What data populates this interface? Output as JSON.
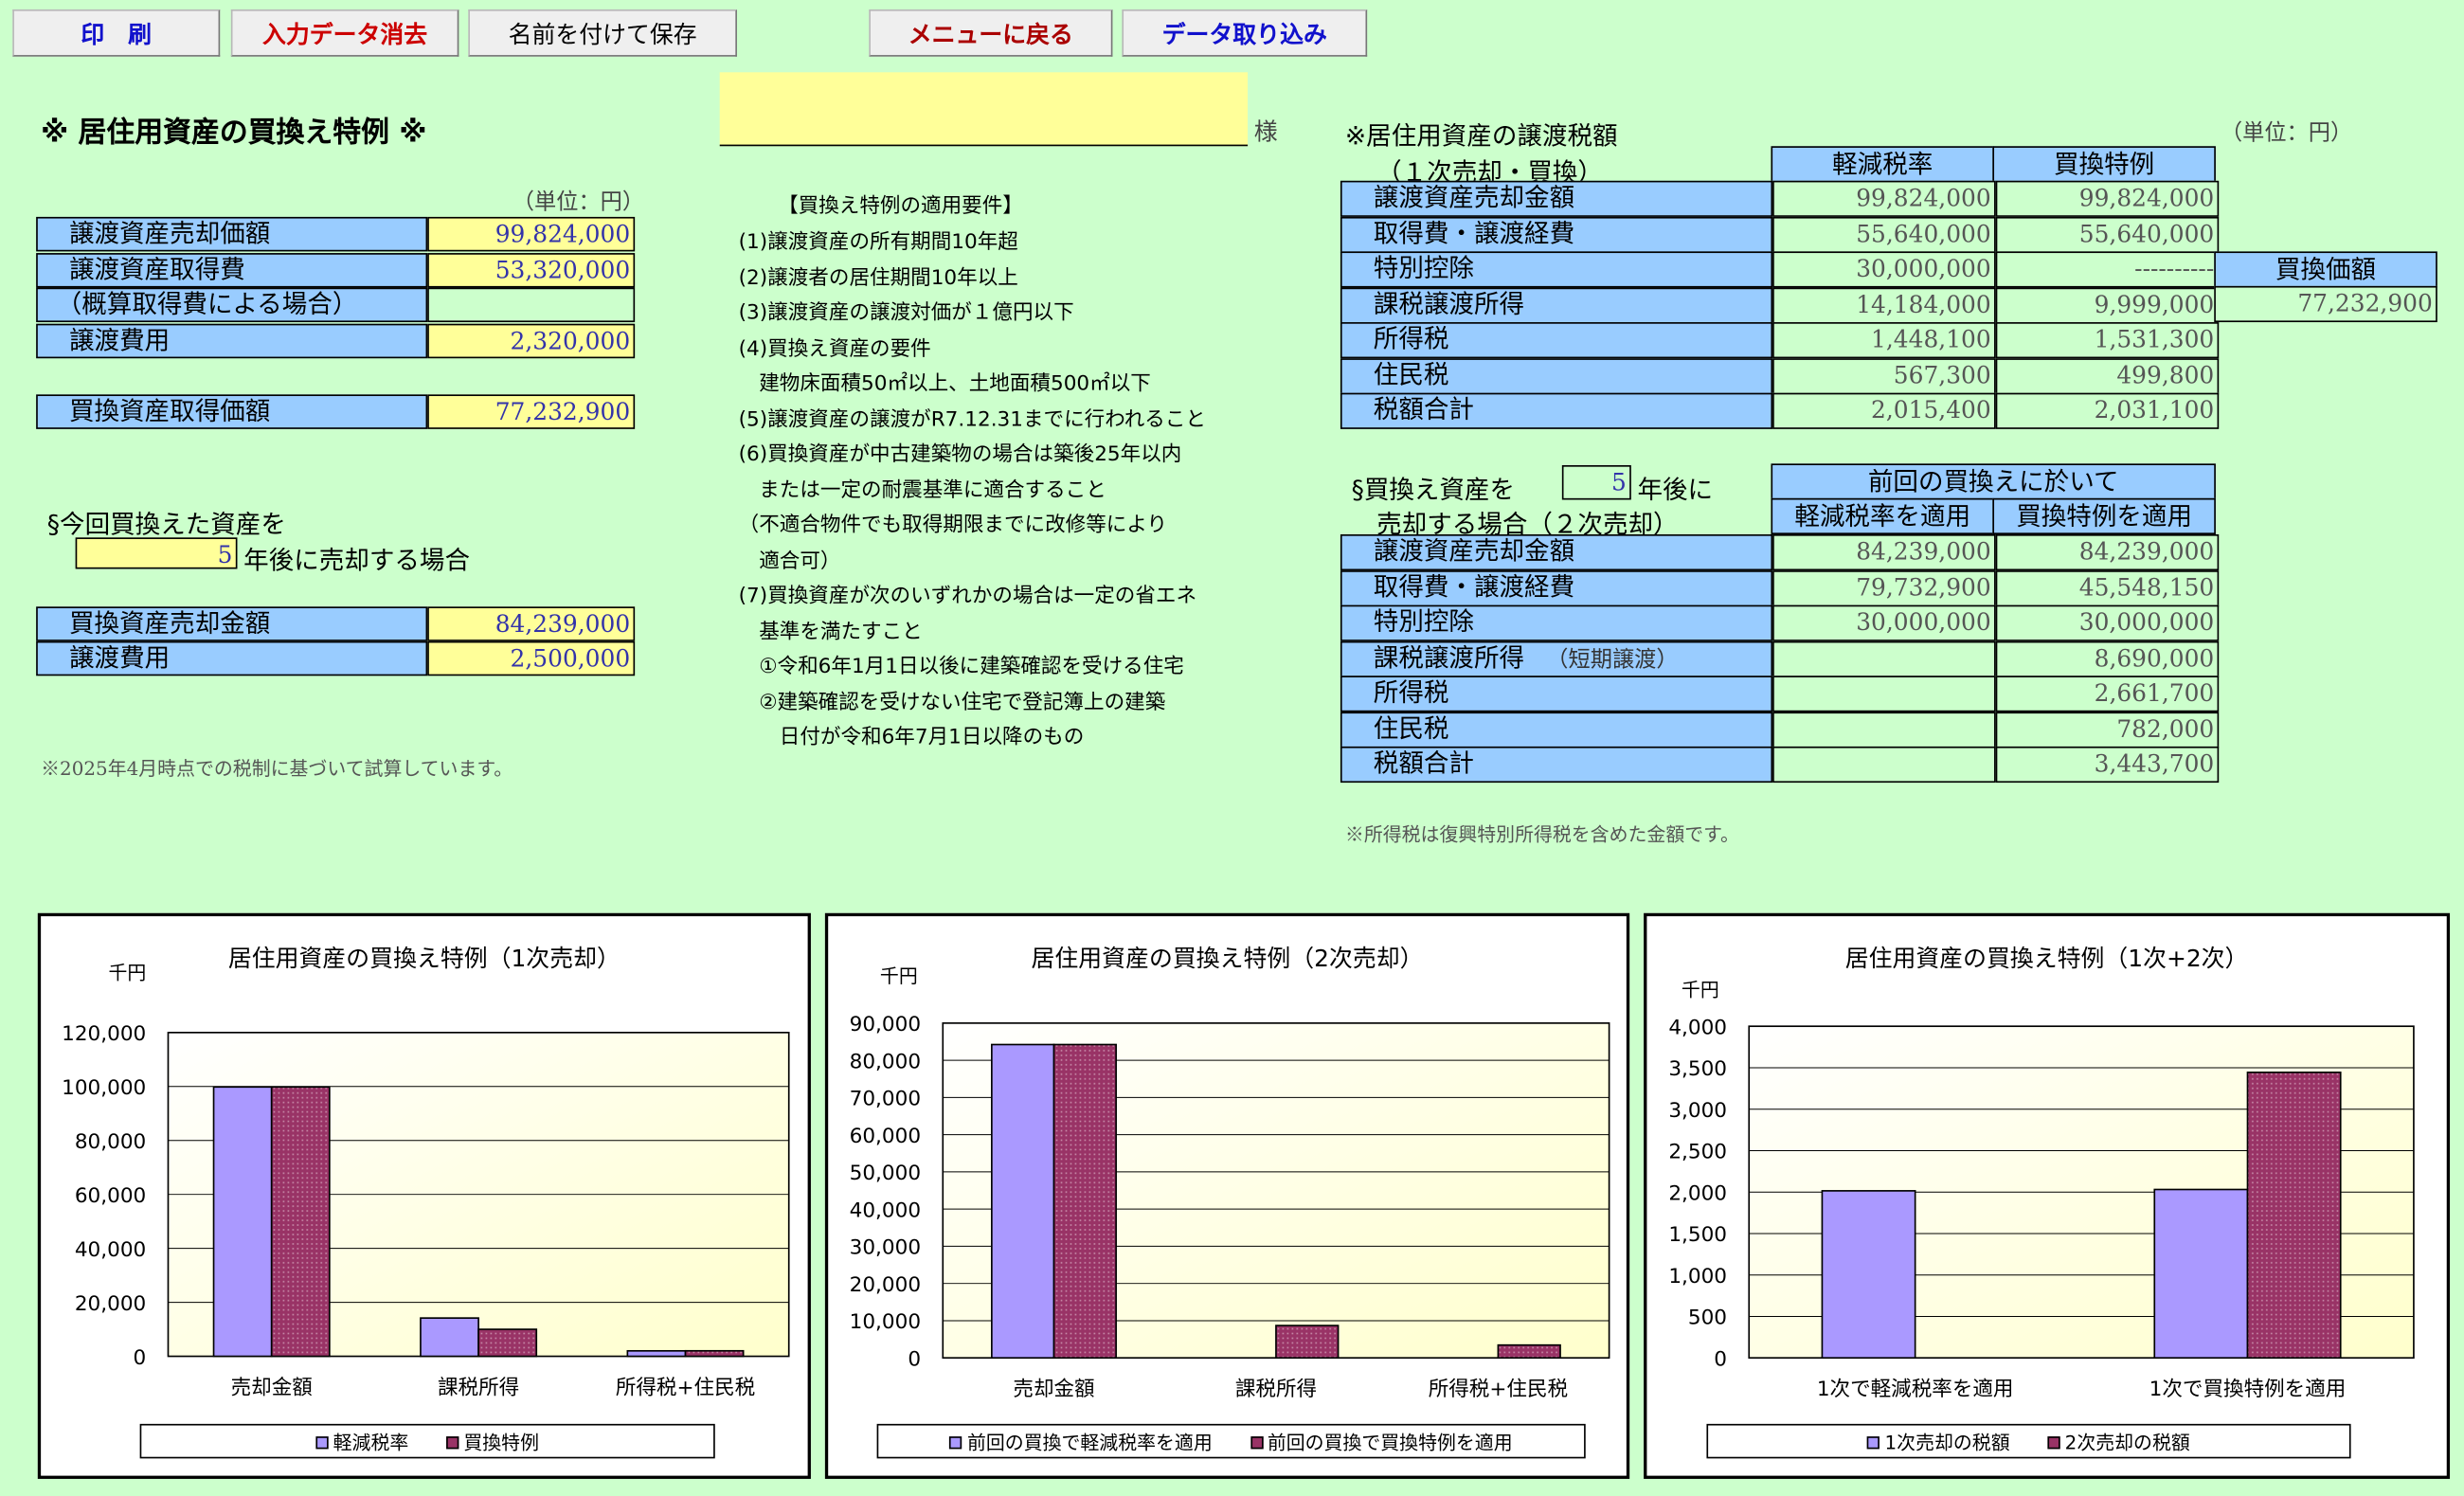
{
  "toolbar": {
    "print": "印　刷",
    "clear": "入力データ消去",
    "save_as": "名前を付けて保存",
    "menu": "メニューに戻る",
    "import": "データ取り込み"
  },
  "colors": {
    "background": "#ccffcc",
    "label_cell": "#99ccff",
    "input_cell": "#ffff99",
    "series_a": "#aa99ff",
    "series_b": "#993366",
    "plot_bg": "#ffffcc"
  },
  "left": {
    "title": "※ 居住用資産の買換え特例 ※",
    "client_name": "",
    "sama": "様",
    "unit": "（単位：円）",
    "rows": [
      {
        "label": "譲渡資産売却価額",
        "value": "99,824,000"
      },
      {
        "label": "譲渡資産取得費",
        "value": "53,320,000"
      },
      {
        "label": "（概算取得費による場合）",
        "value": ""
      },
      {
        "label": "譲渡費用",
        "value": "2,320,000"
      }
    ],
    "replacement": {
      "label": "買換資産取得価額",
      "value": "77,232,900"
    },
    "sale_heading1": "§今回買換えた資産を",
    "sale_years": "5",
    "sale_heading2": "年後に売却する場合",
    "sale_rows": [
      {
        "label": "買換資産売却金額",
        "value": "84,239,000"
      },
      {
        "label": "譲渡費用",
        "value": "2,500,000"
      }
    ],
    "note": "※2025年4月時点での税制に基づいて試算しています。"
  },
  "requirements": {
    "title": "【買換え特例の適用要件】",
    "lines": [
      "(1)譲渡資産の所有期間10年超",
      "(2)譲渡者の居住期間10年以上",
      "(3)譲渡資産の譲渡対価が１億円以下",
      "(4)買換え資産の要件",
      "　建物床面積50㎡以上、土地面積500㎡以下",
      "(5)譲渡資産の譲渡がR7.12.31までに行われること",
      "(6)買換資産が中古建築物の場合は築後25年以内",
      "　または一定の耐震基準に適合すること",
      "（不適合物件でも取得期限までに改修等により",
      "　適合可）",
      "(7)買換資産が次のいずれかの場合は一定の省エネ",
      "　基準を満たすこと",
      "　①令和6年1月1日以後に建築確認を受ける住宅",
      "　②建築確認を受けない住宅で登記簿上の建築",
      "　　日付が令和6年7月1日以降のもの"
    ]
  },
  "right": {
    "title": "※居住用資産の譲渡税額",
    "unit": "（単位：円）",
    "subtitle": "（１次売却・買換）",
    "col1": "軽減税率",
    "col2": "買換特例",
    "rows": [
      {
        "label": "譲渡資産売却金額",
        "a": "99,824,000",
        "b": "99,824,000"
      },
      {
        "label": "取得費・譲渡経費",
        "a": "55,640,000",
        "b": "55,640,000"
      },
      {
        "label": "特別控除",
        "a": "30,000,000",
        "b": "----------"
      },
      {
        "label": "課税譲渡所得",
        "a": "14,184,000",
        "b": "9,999,000"
      },
      {
        "label": "所得税",
        "a": "1,448,100",
        "b": "1,531,300"
      },
      {
        "label": "住民税",
        "a": "567,300",
        "b": "499,800"
      },
      {
        "label": "税額合計",
        "a": "2,015,400",
        "b": "2,031,100"
      }
    ],
    "kaikae_label": "買換価額",
    "kaikae_value": "77,232,900",
    "second_heading1": "§買換え資産を",
    "second_years": "5",
    "second_heading1b": "年後に",
    "second_heading2": "売却する場合（２次売却）",
    "prev_header": "前回の買換えに於いて",
    "col3": "軽減税率を適用",
    "col4": "買換特例を適用",
    "rows2": [
      {
        "label": "譲渡資産売却金額",
        "a": "84,239,000",
        "b": "84,239,000"
      },
      {
        "label": "取得費・譲渡経費",
        "a": "79,732,900",
        "b": "45,548,150"
      },
      {
        "label": "特別控除",
        "a": "30,000,000",
        "b": "30,000,000"
      },
      {
        "label": "課税譲渡所得",
        "extra": "（短期譲渡）",
        "a": "",
        "b": "8,690,000"
      },
      {
        "label": "所得税",
        "a": "",
        "b": "2,661,700"
      },
      {
        "label": "住民税",
        "a": "",
        "b": "782,000"
      },
      {
        "label": "税額合計",
        "a": "",
        "b": "3,443,700"
      }
    ],
    "note": "※所得税は復興特別所得税を含めた金額です。"
  },
  "chart_data": [
    {
      "type": "bar",
      "title": "居住用資産の買換え特例（1次売却）",
      "ylabel": "千円",
      "categories": [
        "売却金額",
        "課税所得",
        "所得税+住民税"
      ],
      "ylim": [
        0,
        120000
      ],
      "yticks": [
        "0",
        "20,000",
        "40,000",
        "60,000",
        "80,000",
        "100,000",
        "120,000"
      ],
      "series": [
        {
          "name": "軽減税率",
          "values": [
            99824,
            14184,
            2015
          ]
        },
        {
          "name": "買換特例",
          "values": [
            99824,
            9999,
            2031
          ]
        }
      ],
      "legend": "bottom"
    },
    {
      "type": "bar",
      "title": "居住用資産の買換え特例（2次売却）",
      "ylabel": "千円",
      "categories": [
        "売却金額",
        "課税所得",
        "所得税+住民税"
      ],
      "ylim": [
        0,
        90000
      ],
      "yticks": [
        "0",
        "10,000",
        "20,000",
        "30,000",
        "40,000",
        "50,000",
        "60,000",
        "70,000",
        "80,000",
        "90,000"
      ],
      "series": [
        {
          "name": "前回の買換で軽減税率を適用",
          "values": [
            84239,
            0,
            0
          ]
        },
        {
          "name": "前回の買換で買換特例を適用",
          "values": [
            84239,
            8690,
            3444
          ]
        }
      ],
      "legend": "bottom"
    },
    {
      "type": "bar",
      "title": "居住用資産の買換え特例（1次+2次）",
      "ylabel": "千円",
      "categories": [
        "1次で軽減税率を適用",
        "1次で買換特例を適用"
      ],
      "ylim": [
        0,
        4000
      ],
      "yticks": [
        "0",
        "500",
        "1,000",
        "1,500",
        "2,000",
        "2,500",
        "3,000",
        "3,500",
        "4,000"
      ],
      "series": [
        {
          "name": "1次売却の税額",
          "values": [
            2015,
            2031
          ]
        },
        {
          "name": "2次売却の税額",
          "values": [
            0,
            3444
          ]
        }
      ],
      "legend": "bottom"
    }
  ]
}
